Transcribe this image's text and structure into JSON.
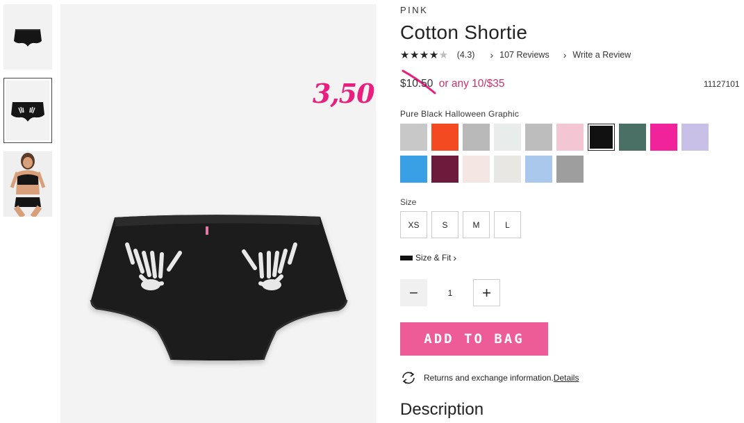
{
  "product": {
    "brand": "PINK",
    "title": "Cotton Shortie",
    "rating_stars": 4,
    "rating_value": "(4.3)",
    "reviews_link": "107 Reviews",
    "write_review": "Write a Review",
    "price_old": "$10.50",
    "price_promo": "or any 10/$35",
    "sku": "11127101",
    "annotation_price": "3,50",
    "color_label": "Pure Black Halloween Graphic",
    "size_label": "Size",
    "sizes": [
      "XS",
      "S",
      "M",
      "L"
    ],
    "size_fit": "Size & Fit",
    "quantity": "1",
    "add_to_bag": "ADD TO BAG",
    "returns_text": "Returns and exchange information.",
    "details_link": "Details",
    "description_heading": "Description"
  },
  "swatches": [
    {
      "name": "heather-gray",
      "color": "#c8c8c8"
    },
    {
      "name": "red-orange",
      "color": "#f44a22"
    },
    {
      "name": "heather-gray-2",
      "color": "#b9b9b9"
    },
    {
      "name": "pastel-tie-dye",
      "color": "#e8ecea"
    },
    {
      "name": "gray",
      "color": "#bdbdbd"
    },
    {
      "name": "pink-floral",
      "color": "#f4c6d4"
    },
    {
      "name": "pure-black",
      "color": "#111111"
    },
    {
      "name": "zebra-green",
      "color": "#4a6f64"
    },
    {
      "name": "hot-pink",
      "color": "#f0239a"
    },
    {
      "name": "lavender-dots",
      "color": "#c8c0e6"
    },
    {
      "name": "blue-print",
      "color": "#3aa0e6"
    },
    {
      "name": "burgundy",
      "color": "#6e1a3c"
    },
    {
      "name": "cherries",
      "color": "#f3e6e3"
    },
    {
      "name": "ivory",
      "color": "#e9e7e4"
    },
    {
      "name": "light-blue-dots",
      "color": "#a9c8ec"
    },
    {
      "name": "gray-hearts",
      "color": "#9e9e9e"
    }
  ]
}
